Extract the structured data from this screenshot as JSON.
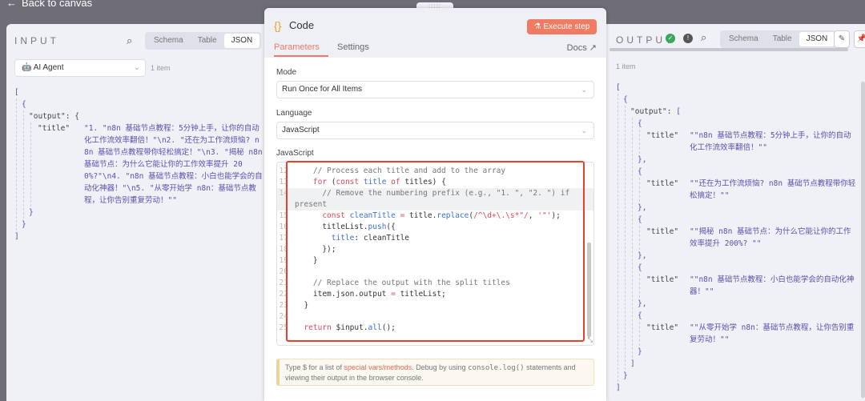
{
  "nav": {
    "back_label": "Back to canvas"
  },
  "input": {
    "title": "INPUT",
    "tabs": [
      "Schema",
      "Table",
      "JSON"
    ],
    "active_tab": "JSON",
    "source_node": "AI Agent",
    "item_count": "1 item",
    "key_output": "\"output\"",
    "key_title": "\"title\"",
    "title_value": "\"1. \"n8n 基础节点教程：5分钟上手，让你的自动化工作流效率翻倍！\"\\n2. \"还在为工作流烦恼? n8n 基础节点教程带你轻松搞定！\"\\n3. \"揭秘 n8n 基础节点：为什么它能让你的工作效率提升 200%?\"\\n4. \"n8n 基础节点教程：小白也能学会的自动化神器！\"\\n5. \"从零开始学 n8n：基础节点教程，让你告别重复劳动！\"\""
  },
  "node": {
    "title": "Code",
    "execute_label": "Execute step",
    "tabs": [
      "Parameters",
      "Settings"
    ],
    "active_tab": "Parameters",
    "docs_label": "Docs",
    "mode_label": "Mode",
    "mode_value": "Run Once for All Items",
    "language_label": "Language",
    "language_value": "JavaScript",
    "code_label": "JavaScript",
    "code_lines": [
      {
        "n": "12",
        "seg": [
          [
            "",
            "    "
          ],
          [
            "c-cm",
            "// Process each title and add to the array"
          ]
        ]
      },
      {
        "n": "13",
        "seg": [
          [
            "",
            "    "
          ],
          [
            "c-kw",
            "for"
          ],
          [
            "c-id",
            " ("
          ],
          [
            "c-kw",
            "const"
          ],
          [
            "c-fn",
            " title"
          ],
          [
            "c-kw",
            " of"
          ],
          [
            "c-id",
            " titles) {"
          ]
        ]
      },
      {
        "n": "14",
        "hl": true,
        "seg": [
          [
            "",
            "      "
          ],
          [
            "c-cm",
            "// Remove the numbering prefix (e.g., \"1. \", \"2. \") if"
          ]
        ]
      },
      {
        "n": "",
        "hl": true,
        "seg": [
          [
            "c-cm",
            "present"
          ]
        ]
      },
      {
        "n": "15",
        "seg": [
          [
            "",
            "      "
          ],
          [
            "c-kw",
            "const"
          ],
          [
            "c-fn",
            " cleanTitle"
          ],
          [
            "c-kw",
            " ="
          ],
          [
            "c-id",
            " title."
          ],
          [
            "c-fn",
            "replace"
          ],
          [
            "c-id",
            "("
          ],
          [
            "c-rx",
            "/^\\d+\\.\\s*\"/"
          ],
          [
            "c-id",
            ", "
          ],
          [
            "c-rx",
            "'\"'"
          ],
          [
            "c-id",
            ");"
          ]
        ]
      },
      {
        "n": "16",
        "seg": [
          [
            "",
            "      "
          ],
          [
            "c-id",
            "titleList."
          ],
          [
            "c-fn",
            "push"
          ],
          [
            "c-id",
            "({"
          ]
        ]
      },
      {
        "n": "17",
        "seg": [
          [
            "",
            "        "
          ],
          [
            "c-fn",
            "title"
          ],
          [
            "c-id",
            ": cleanTitle"
          ]
        ]
      },
      {
        "n": "18",
        "seg": [
          [
            "",
            "      "
          ],
          [
            "c-id",
            "});"
          ]
        ]
      },
      {
        "n": "19",
        "seg": [
          [
            "",
            "    "
          ],
          [
            "c-id",
            "}"
          ]
        ]
      },
      {
        "n": "20",
        "seg": []
      },
      {
        "n": "21",
        "seg": [
          [
            "",
            "    "
          ],
          [
            "c-cm",
            "// Replace the output with the split titles"
          ]
        ]
      },
      {
        "n": "22",
        "seg": [
          [
            "",
            "    "
          ],
          [
            "c-id",
            "item.json.output"
          ],
          [
            "c-kw",
            " ="
          ],
          [
            "c-id",
            " titleList;"
          ]
        ]
      },
      {
        "n": "23",
        "seg": [
          [
            "",
            "  "
          ],
          [
            "c-id",
            "}"
          ]
        ]
      },
      {
        "n": "24",
        "seg": []
      },
      {
        "n": "25",
        "seg": [
          [
            "",
            "  "
          ],
          [
            "c-kw",
            "return"
          ],
          [
            "c-id",
            " $input."
          ],
          [
            "c-fn",
            "all"
          ],
          [
            "c-id",
            "();"
          ]
        ]
      }
    ],
    "hint_pre": "Type $ for a list of ",
    "hint_link": "special vars/methods",
    "hint_mid": ". Debug by using ",
    "hint_code": "console.log()",
    "hint_post": " statements and viewing their output in the browser console."
  },
  "output": {
    "title": "OUTPUT",
    "tabs": [
      "Schema",
      "Table",
      "JSON"
    ],
    "active_tab": "JSON",
    "item_count": "1 item",
    "key_output": "\"output\"",
    "key_title": "\"title\"",
    "titles": [
      "\"\"n8n 基础节点教程：5分钟上手，让你的自动化工作流效率翻倍！\"\"",
      "\"\"还在为工作流烦恼? n8n 基础节点教程带你轻松搞定！\"\"",
      "\"\"揭秘 n8n 基础节点：为什么它能让你的工作效率提升 200%? \"\"",
      "\"\"n8n 基础节点教程：小白也能学会的自动化神器！\"\"",
      "\"\"从零开始学 n8n：基础节点教程，让你告别重复劳动！\"\""
    ]
  },
  "colors": {
    "accent": "#ee7b62",
    "success": "#3aa55d",
    "highlight_box": "#e8402f"
  }
}
